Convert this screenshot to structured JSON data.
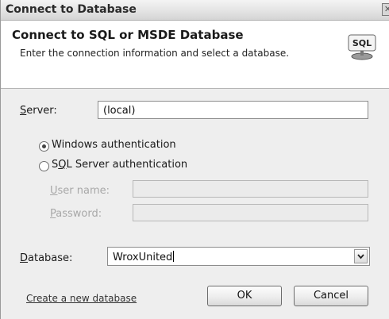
{
  "window": {
    "title": "Connect to Database",
    "close_glyph": "✕"
  },
  "header": {
    "title": "Connect to SQL or MSDE Database",
    "subtitle": "Enter the connection information and select a database.",
    "icon": "sql-server-icon",
    "icon_text": "SQL"
  },
  "server": {
    "label_mnemonic": "S",
    "label_rest": "erver:",
    "value": "(local)"
  },
  "auth": {
    "selected": "windows",
    "windows_label": "Windows authentication",
    "sql_label_pre": "S",
    "sql_label_mnemonic": "Q",
    "sql_label_rest": "L Server authentication"
  },
  "credentials": {
    "username_mnemonic": "U",
    "username_rest": "ser name:",
    "username_value": "",
    "password_mnemonic": "P",
    "password_rest": "assword:",
    "password_value": ""
  },
  "database": {
    "label_mnemonic": "D",
    "label_rest": "atabase:",
    "value": "WroxUnited"
  },
  "footer": {
    "create_link": "Create a new database",
    "ok_label": "OK",
    "cancel_label": "Cancel"
  }
}
